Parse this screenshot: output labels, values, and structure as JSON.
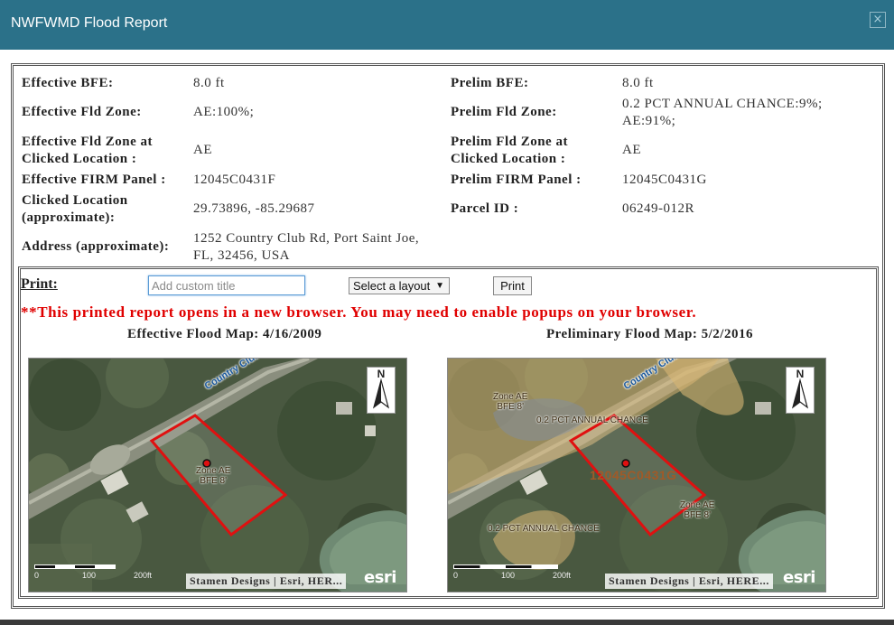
{
  "dialog": {
    "title": "NWFWMD Flood Report",
    "close_symbol": "×"
  },
  "info": {
    "effective_bfe_label": "Effective BFE:",
    "effective_bfe_value": "8.0 ft",
    "prelim_bfe_label": "Prelim BFE:",
    "prelim_bfe_value": "8.0 ft",
    "effective_zone_label": "Effective Fld Zone:",
    "effective_zone_value": "AE:100%;",
    "prelim_zone_label": "Prelim Fld Zone:",
    "prelim_zone_value_line1": "0.2 PCT ANNUAL CHANCE:9%;",
    "prelim_zone_value_line2": "AE:91%;",
    "effective_zone_clicked_label_line1": "Effective Fld Zone at",
    "effective_zone_clicked_label_line2": "Clicked Location :",
    "effective_zone_clicked_value": "AE",
    "prelim_zone_clicked_label_line1": "Prelim Fld Zone at",
    "prelim_zone_clicked_label_line2": "Clicked Location :",
    "prelim_zone_clicked_value": "AE",
    "effective_panel_label": "Effective FIRM Panel :",
    "effective_panel_value": "12045C0431F",
    "prelim_panel_label": "Prelim FIRM Panel :",
    "prelim_panel_value": "12045C0431G",
    "clicked_location_label_line1": "Clicked Location",
    "clicked_location_label_line2": "(approximate):",
    "clicked_location_value": "29.73896, -85.29687",
    "parcel_id_label": "Parcel ID :",
    "parcel_id_value": "06249-012R",
    "address_label": "Address (approximate):",
    "address_value_line1": "1252 Country Club Rd, Port Saint Joe,",
    "address_value_line2": "FL, 32456, USA"
  },
  "print": {
    "label": "Print:",
    "title_placeholder": "Add custom title",
    "layout_select_value": "Select a layout",
    "layout_arrow": "▼",
    "print_button": "Print",
    "warning": "**This printed report opens in a new browser. You may need to enable popups on your browser."
  },
  "maps": {
    "effective": {
      "title": "Effective Flood Map: 4/16/2009",
      "road_label": "Country Club",
      "zone_label_line1": "Zone AE",
      "zone_label_line2": "BFE 8'",
      "north": "N",
      "scale_0": "0",
      "scale_100": "100",
      "scale_200": "200ft",
      "attribution": "Stamen Designs | Esri, HER...",
      "esri": "esri"
    },
    "preliminary": {
      "title": "Preliminary Flood Map: 5/2/2016",
      "road_label": "Country Club",
      "zone_label1_line1": "Zone AE",
      "zone_label1_line2": "BFE 8'",
      "zone_label2_line1": "Zone AE",
      "zone_label2_line2": "BFE 8'",
      "pct_label_top": "0.2 PCT ANNUAL CHANCE",
      "pct_label_bottom": "0.2 PCT ANNUAL CHANCE",
      "panel_number": "12045C0431G",
      "north": "N",
      "scale_0": "0",
      "scale_100": "100",
      "scale_200": "200ft",
      "attribution": "Stamen Designs | Esri, HERE...",
      "esri": "esri"
    }
  },
  "colors": {
    "titlebar": "#2b7189",
    "warning": "#e00000",
    "parcel_outline": "#e01010",
    "pct_zone_fill": "#d9b774"
  }
}
